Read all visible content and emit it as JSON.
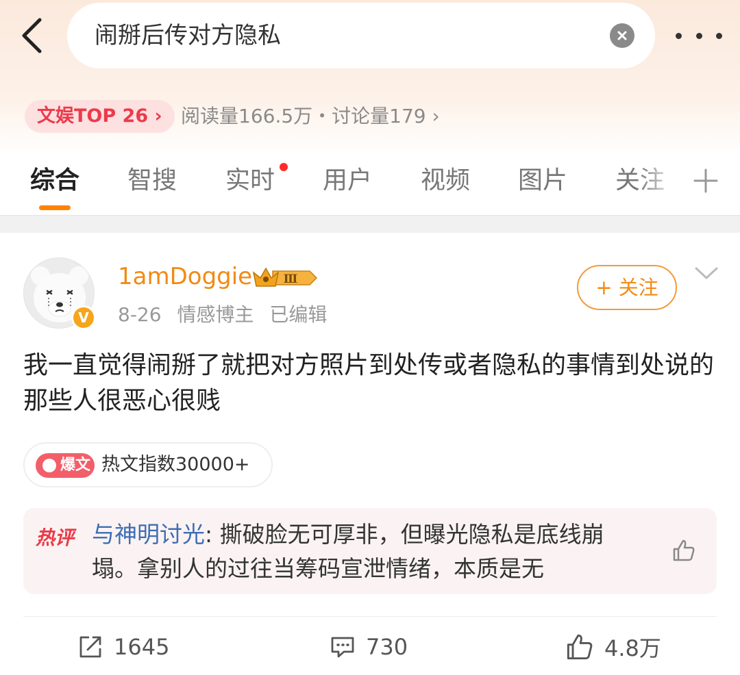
{
  "search": {
    "query": "闹掰后传对方隐私"
  },
  "topic": {
    "rank_label": "文娱TOP 26",
    "stats": "阅读量166.5万・讨论量179"
  },
  "tabs": [
    {
      "label": "综合"
    },
    {
      "label": "智搜"
    },
    {
      "label": "实时"
    },
    {
      "label": "用户"
    },
    {
      "label": "视频"
    },
    {
      "label": "图片"
    },
    {
      "label": "关注"
    }
  ],
  "post": {
    "username": "1amDoggie",
    "vip_level": "Ⅲ",
    "verified_badge": "V",
    "date": "8-26",
    "author_tag": "情感博主",
    "edited": "已编辑",
    "follow_label": "+ 关注",
    "text": "我一直觉得闹掰了就把对方照片到处传或者隐私的事情到处说的那些人很恶心很贱",
    "hot_tag": "爆文",
    "hot_index": "热文指数30000+",
    "hot_comment": {
      "label": "热评",
      "user": "与神明讨光",
      "text": "撕破脸无可厚非，但曝光隐私是底线崩塌。拿别人的过往当筹码宣泄情绪，本质是无"
    },
    "actions": {
      "reposts": "1645",
      "comments": "730",
      "likes": "4.8万"
    }
  },
  "colors": {
    "accent": "#ff8200",
    "username": "#f28a14",
    "hot_red": "#ea3a47",
    "link_blue": "#3d6db4"
  },
  "icons": [
    "back-icon",
    "clear-icon",
    "more-icon",
    "plus-icon",
    "chevron-down-icon",
    "crown-icon",
    "repost-icon",
    "comment-icon",
    "like-icon"
  ]
}
